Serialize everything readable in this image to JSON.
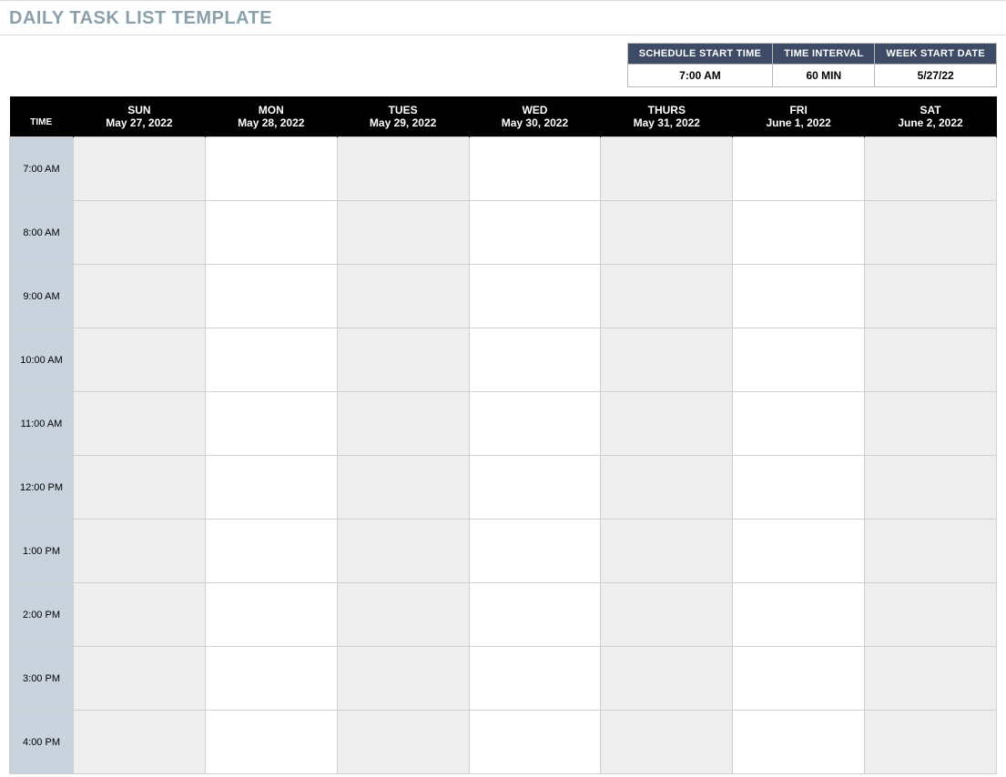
{
  "title": "DAILY TASK LIST TEMPLATE",
  "config": {
    "headers": {
      "start_time": "SCHEDULE START TIME",
      "interval": "TIME INTERVAL",
      "week_start": "WEEK START DATE"
    },
    "values": {
      "start_time": "7:00 AM",
      "interval": "60 MIN",
      "week_start": "5/27/22"
    }
  },
  "schedule": {
    "time_header": "TIME",
    "days": [
      {
        "name": "SUN",
        "date": "May 27, 2022"
      },
      {
        "name": "MON",
        "date": "May 28, 2022"
      },
      {
        "name": "TUES",
        "date": "May 29, 2022"
      },
      {
        "name": "WED",
        "date": "May 30, 2022"
      },
      {
        "name": "THURS",
        "date": "May 31, 2022"
      },
      {
        "name": "FRI",
        "date": "June 1, 2022"
      },
      {
        "name": "SAT",
        "date": "June 2, 2022"
      }
    ],
    "times": [
      "7:00 AM",
      "8:00 AM",
      "9:00 AM",
      "10:00 AM",
      "11:00 AM",
      "12:00 PM",
      "1:00 PM",
      "2:00 PM",
      "3:00 PM",
      "4:00 PM"
    ],
    "shaded_day_indices": [
      0,
      2,
      4,
      6
    ]
  }
}
